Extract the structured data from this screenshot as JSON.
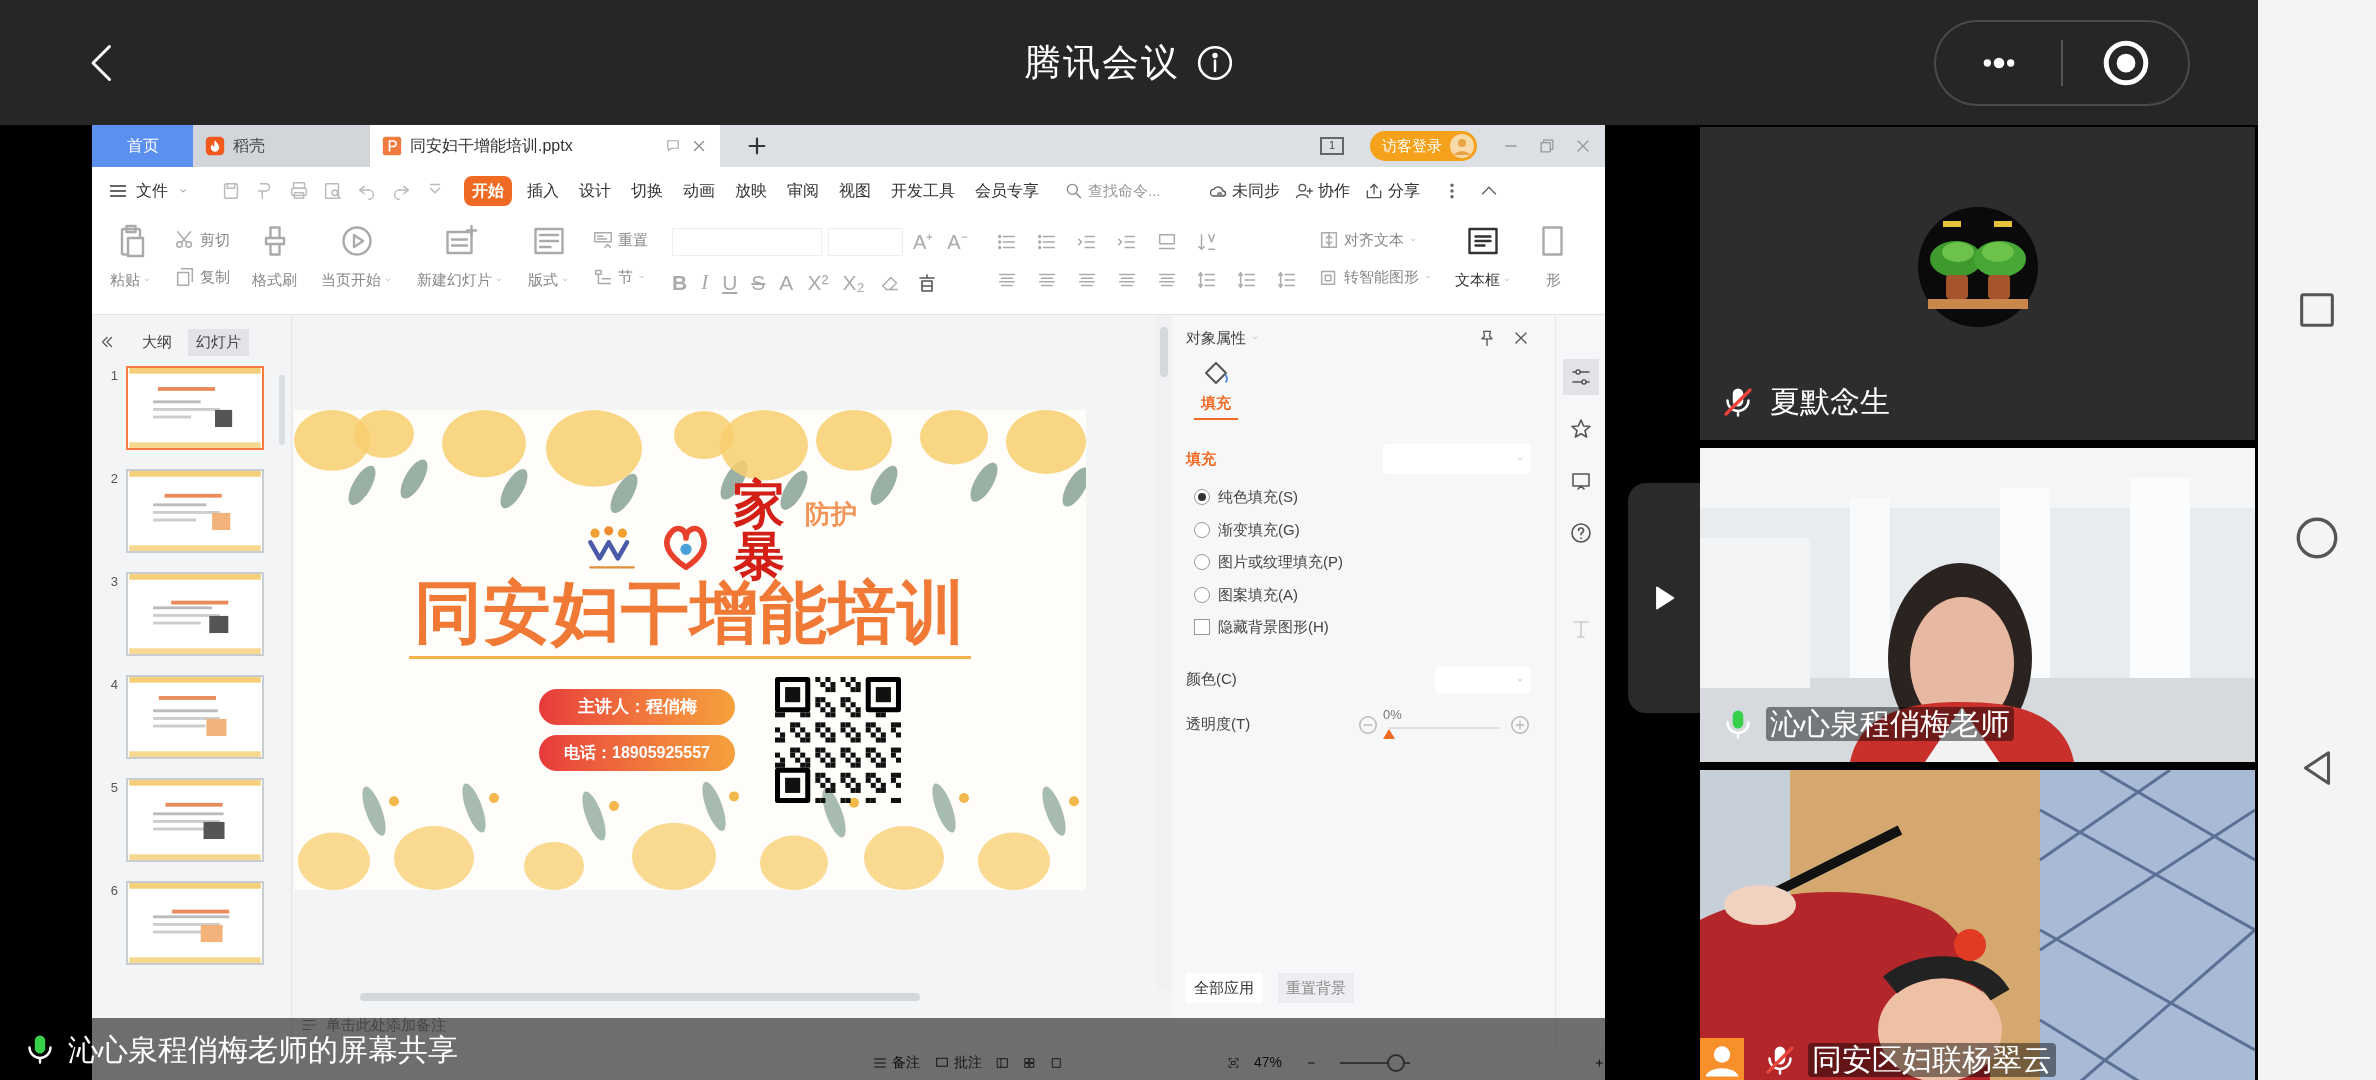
{
  "top_bar": {
    "title": "腾讯会议"
  },
  "wps": {
    "tabs": [
      {
        "kind": "home",
        "label": "首页",
        "selected": false
      },
      {
        "kind": "docer",
        "label": "稻壳",
        "selected": false
      },
      {
        "kind": "document",
        "label": "同安妇干增能培训.pptx",
        "selected": true
      }
    ],
    "page_indicator": "1",
    "login_button": "访客登录",
    "menu": {
      "file": "文件",
      "tabs": [
        {
          "label": "开始",
          "selected": true
        },
        {
          "label": "插入",
          "selected": false
        },
        {
          "label": "设计",
          "selected": false
        },
        {
          "label": "切换",
          "selected": false
        },
        {
          "label": "动画",
          "selected": false
        },
        {
          "label": "放映",
          "selected": false
        },
        {
          "label": "审阅",
          "selected": false
        },
        {
          "label": "视图",
          "selected": false
        },
        {
          "label": "开发工具",
          "selected": false
        },
        {
          "label": "会员专享",
          "selected": false
        }
      ],
      "search_placeholder": "查找命令...",
      "actions": [
        "未同步",
        "协作",
        "分享"
      ]
    },
    "ribbon": [
      {
        "kind": "big",
        "label": "粘贴",
        "dropdown": true
      },
      {
        "kind": "pair",
        "items": [
          {
            "label": "剪切",
            "dropdown": false
          },
          {
            "label": "复制",
            "dropdown": false
          }
        ]
      },
      {
        "kind": "big",
        "label": "格式刷",
        "dropdown": false
      },
      {
        "kind": "big",
        "label": "当页开始",
        "dropdown": true
      },
      {
        "kind": "big",
        "label": "新建幻灯片",
        "dropdown": true
      },
      {
        "kind": "big",
        "label": "版式",
        "dropdown": true
      },
      {
        "kind": "pair",
        "items": [
          {
            "label": "重置",
            "dropdown": false
          },
          {
            "label": "节",
            "dropdown": true
          }
        ]
      },
      {
        "kind": "font",
        "size_buttons": [
          "A⁺",
          "A⁻"
        ],
        "format": [
          "B",
          "I",
          "U",
          "S",
          "A",
          "X²",
          "X₂"
        ]
      },
      {
        "kind": "paragraph"
      },
      {
        "kind": "pair",
        "items": [
          {
            "label": "对齐文本",
            "dropdown": true
          },
          {
            "label": "转智能图形",
            "dropdown": true
          }
        ]
      },
      {
        "kind": "big",
        "label": "文本框",
        "dropdown": true
      },
      {
        "kind": "big",
        "label": "形",
        "dropdown": false
      }
    ],
    "slide_pane": {
      "tabs": [
        {
          "label": "大纲",
          "selected": false
        },
        {
          "label": "幻灯片",
          "selected": true
        }
      ],
      "slides": [
        {
          "number": "1",
          "selected": true
        },
        {
          "number": "2",
          "selected": false
        },
        {
          "number": "3",
          "selected": false
        },
        {
          "number": "4",
          "selected": false
        },
        {
          "number": "5",
          "selected": false
        },
        {
          "number": "6",
          "selected": false
        }
      ]
    },
    "slide": {
      "accent": "家暴",
      "tag": "防护",
      "title": "同安妇干增能培训",
      "speaker": "主讲人：程俏梅",
      "phone": "电话：18905925557"
    },
    "notes_placeholder": "单击此处添加备注",
    "properties": {
      "title": "对象属性",
      "tab": "填充",
      "section": "填充",
      "fill_options": [
        {
          "kind": "radio",
          "label": "纯色填充(S)",
          "selected": true
        },
        {
          "kind": "radio",
          "label": "渐变填充(G)",
          "selected": false
        },
        {
          "kind": "radio",
          "label": "图片或纹理填充(P)",
          "selected": false
        },
        {
          "kind": "radio",
          "label": "图案填充(A)",
          "selected": false
        },
        {
          "kind": "checkbox",
          "label": "隐藏背景图形(H)",
          "checked": false
        }
      ],
      "color_label": "颜色(C)",
      "transparency": {
        "label": "透明度(T)",
        "reading": "0%",
        "level": 0
      },
      "buttons": [
        {
          "label": "全部应用",
          "disabled": false
        },
        {
          "label": "重置背景",
          "disabled": true
        }
      ]
    },
    "status_bar": {
      "notes": "备注",
      "comments": "批注",
      "zoom": "47%",
      "zoom_slider": {
        "level": 0.8
      }
    }
  },
  "share_banner": {
    "text": "沁心泉程俏梅老师的屏幕共享"
  },
  "participants": [
    {
      "kind": "avatar",
      "name": "夏默念生",
      "muted": true,
      "avatar_badge": false
    },
    {
      "kind": "video",
      "name": "沁心泉程俏梅老师",
      "muted": false,
      "avatar_badge": false
    },
    {
      "kind": "video",
      "name": "同安区妇联杨翠云",
      "muted": true,
      "avatar_badge": true
    }
  ]
}
